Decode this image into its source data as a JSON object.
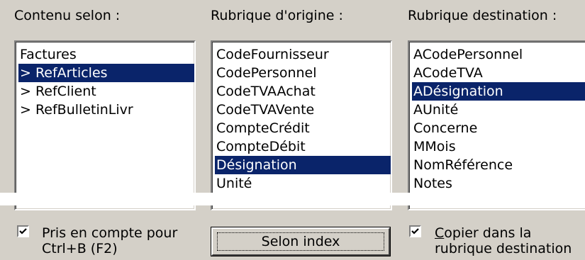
{
  "columns": {
    "contenu": {
      "label": "Contenu selon :",
      "items": [
        "Factures",
        "> RefArticles",
        "> RefClient",
        "> RefBulletinLivr"
      ],
      "selected_index": 1
    },
    "origine": {
      "label": "Rubrique d'origine :",
      "items": [
        "CodeFournisseur",
        "CodePersonnel",
        "CodeTVAAchat",
        "CodeTVAVente",
        "CompteCrédit",
        "CompteDébit",
        "Désignation",
        "Unité"
      ],
      "selected_index": 6
    },
    "destination": {
      "label": "Rubrique destination :",
      "items": [
        "ACodePersonnel",
        "ACodeTVA",
        "ADésignation",
        "AUnité",
        "Concerne",
        "MMois",
        "NomRéférence",
        "Notes"
      ],
      "selected_index": 2
    }
  },
  "options": {
    "pris_en_compte": {
      "checked": true,
      "line1": "Pris en compte pour",
      "line2": "Ctrl+B (F2)"
    },
    "copier": {
      "checked": true,
      "mnemonic": "C",
      "line1_rest": "opier dans la",
      "line2": "rubrique destination"
    }
  },
  "button": {
    "label": "Selon index"
  },
  "colors": {
    "face": "#d4d0c8",
    "selection": "#0a246a",
    "window": "#ffffff"
  }
}
